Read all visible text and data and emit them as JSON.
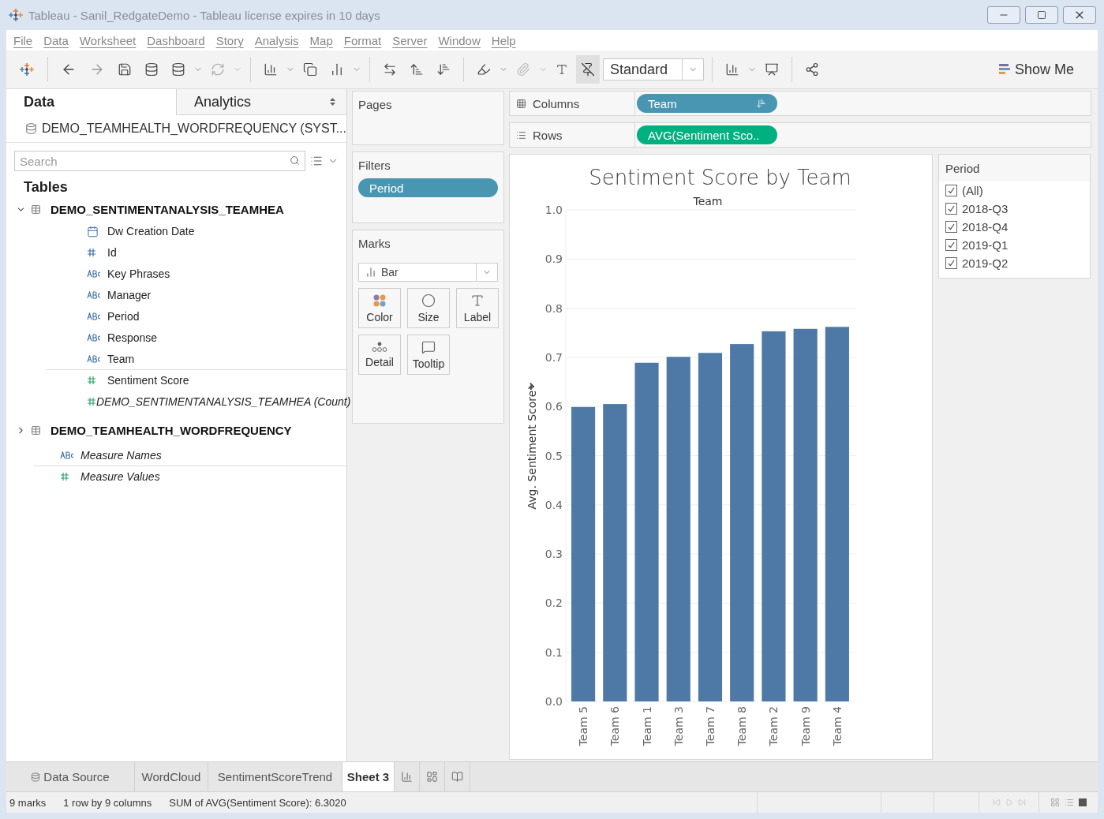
{
  "window": {
    "title": "Tableau - Sanil_RedgateDemo - Tableau license expires in 10 days"
  },
  "menu": [
    "File",
    "Data",
    "Worksheet",
    "Dashboard",
    "Story",
    "Analysis",
    "Map",
    "Format",
    "Server",
    "Window",
    "Help"
  ],
  "toolbar": {
    "fit": "Standard",
    "show_me": "Show Me"
  },
  "data_pane": {
    "tabs": [
      {
        "label": "Data",
        "selected": true
      },
      {
        "label": "Analytics",
        "selected": false
      }
    ],
    "datasource": "DEMO_TEAMHEALTH_WORDFREQUENCY (SYST...",
    "search": {
      "placeholder": "Search"
    },
    "tables_heading": "Tables",
    "tables": [
      {
        "name": "DEMO_SENTIMENTANALYSIS_TEAMHEA",
        "expanded": true,
        "fields": [
          {
            "name": "Dw Creation Date",
            "kind": "date",
            "generated": false
          },
          {
            "name": "Id",
            "kind": "id",
            "generated": false
          },
          {
            "name": "Key Phrases",
            "kind": "text",
            "generated": false
          },
          {
            "name": "Manager",
            "kind": "text",
            "generated": false
          },
          {
            "name": "Period",
            "kind": "text",
            "generated": false
          },
          {
            "name": "Response",
            "kind": "text",
            "generated": false
          },
          {
            "name": "Team",
            "kind": "text",
            "generated": false
          },
          {
            "name": "Sentiment Score",
            "kind": "measure",
            "generated": false
          },
          {
            "name": "DEMO_SENTIMENTANALYSIS_TEAMHEA (Count)",
            "kind": "measure",
            "generated": true
          }
        ]
      },
      {
        "name": "DEMO_TEAMHEALTH_WORDFREQUENCY",
        "expanded": false
      }
    ],
    "fields": [
      {
        "name": "Measure Names",
        "kind": "text",
        "generated": true
      },
      {
        "name": "Measure Values",
        "kind": "measure",
        "generated": true
      }
    ]
  },
  "pages": {
    "label": "Pages"
  },
  "filters": {
    "label": "Filters",
    "pills": [
      "Period"
    ]
  },
  "marks": {
    "label": "Marks",
    "type": "Bar",
    "cards": [
      {
        "label": "Color",
        "kind": "color"
      },
      {
        "label": "Size",
        "kind": "size"
      },
      {
        "label": "Label",
        "kind": "label"
      },
      {
        "label": "Detail",
        "kind": "detail"
      },
      {
        "label": "Tooltip",
        "kind": "tooltip"
      }
    ]
  },
  "shelves": [
    {
      "label": "Columns",
      "kind": "columns",
      "pills": [
        {
          "text": "Team",
          "kind": "discrete",
          "sorted": true
        }
      ]
    },
    {
      "label": "Rows",
      "kind": "rows",
      "pills": [
        {
          "text": "AVG(Sentiment Sco..",
          "kind": "continuous",
          "sorted": false
        }
      ]
    }
  ],
  "view": {
    "title": "Sentiment Score by Team",
    "header": "Team",
    "chart_data": {
      "type": "bar",
      "grid": true,
      "ylabel": "Avg. Sentiment Score",
      "categories": [
        "Team 5",
        "Team 6",
        "Team 1",
        "Team 3",
        "Team 7",
        "Team 8",
        "Team 2",
        "Team 9",
        "Team 4"
      ],
      "values": [
        0.599,
        0.605,
        0.689,
        0.701,
        0.709,
        0.727,
        0.753,
        0.758,
        0.762
      ],
      "ylim": [
        0,
        1
      ],
      "yticks": [
        {
          "value": 0,
          "label": "0.0"
        },
        {
          "value": 0.1,
          "label": "0.1"
        },
        {
          "value": 0.2,
          "label": "0.2"
        },
        {
          "value": 0.3,
          "label": "0.3"
        },
        {
          "value": 0.4,
          "label": "0.4"
        },
        {
          "value": 0.5,
          "label": "0.5"
        },
        {
          "value": 0.6,
          "label": "0.6"
        },
        {
          "value": 0.7,
          "label": "0.7"
        },
        {
          "value": 0.8,
          "label": "0.8"
        },
        {
          "value": 0.9,
          "label": "0.9"
        },
        {
          "value": 1,
          "label": "1.0"
        }
      ]
    }
  },
  "period_filter": {
    "title": "Period",
    "items": [
      {
        "label": "(All)",
        "checked": true
      },
      {
        "label": "2018-Q3",
        "checked": true
      },
      {
        "label": "2018-Q4",
        "checked": true
      },
      {
        "label": "2019-Q1",
        "checked": true
      },
      {
        "label": "2019-Q2",
        "checked": true
      }
    ]
  },
  "sheet_tabs": [
    {
      "label": "Data Source",
      "kind": "datasource",
      "selected": false
    },
    {
      "label": "WordCloud",
      "kind": "sheet",
      "selected": false
    },
    {
      "label": "SentimentScoreTrend",
      "kind": "sheet",
      "selected": false
    },
    {
      "label": "Sheet 3",
      "kind": "sheet",
      "selected": true
    }
  ],
  "status_bar": [
    "9 marks",
    "1 row by 9 columns",
    "SUM of AVG(Sentiment Score): 6.3020"
  ]
}
